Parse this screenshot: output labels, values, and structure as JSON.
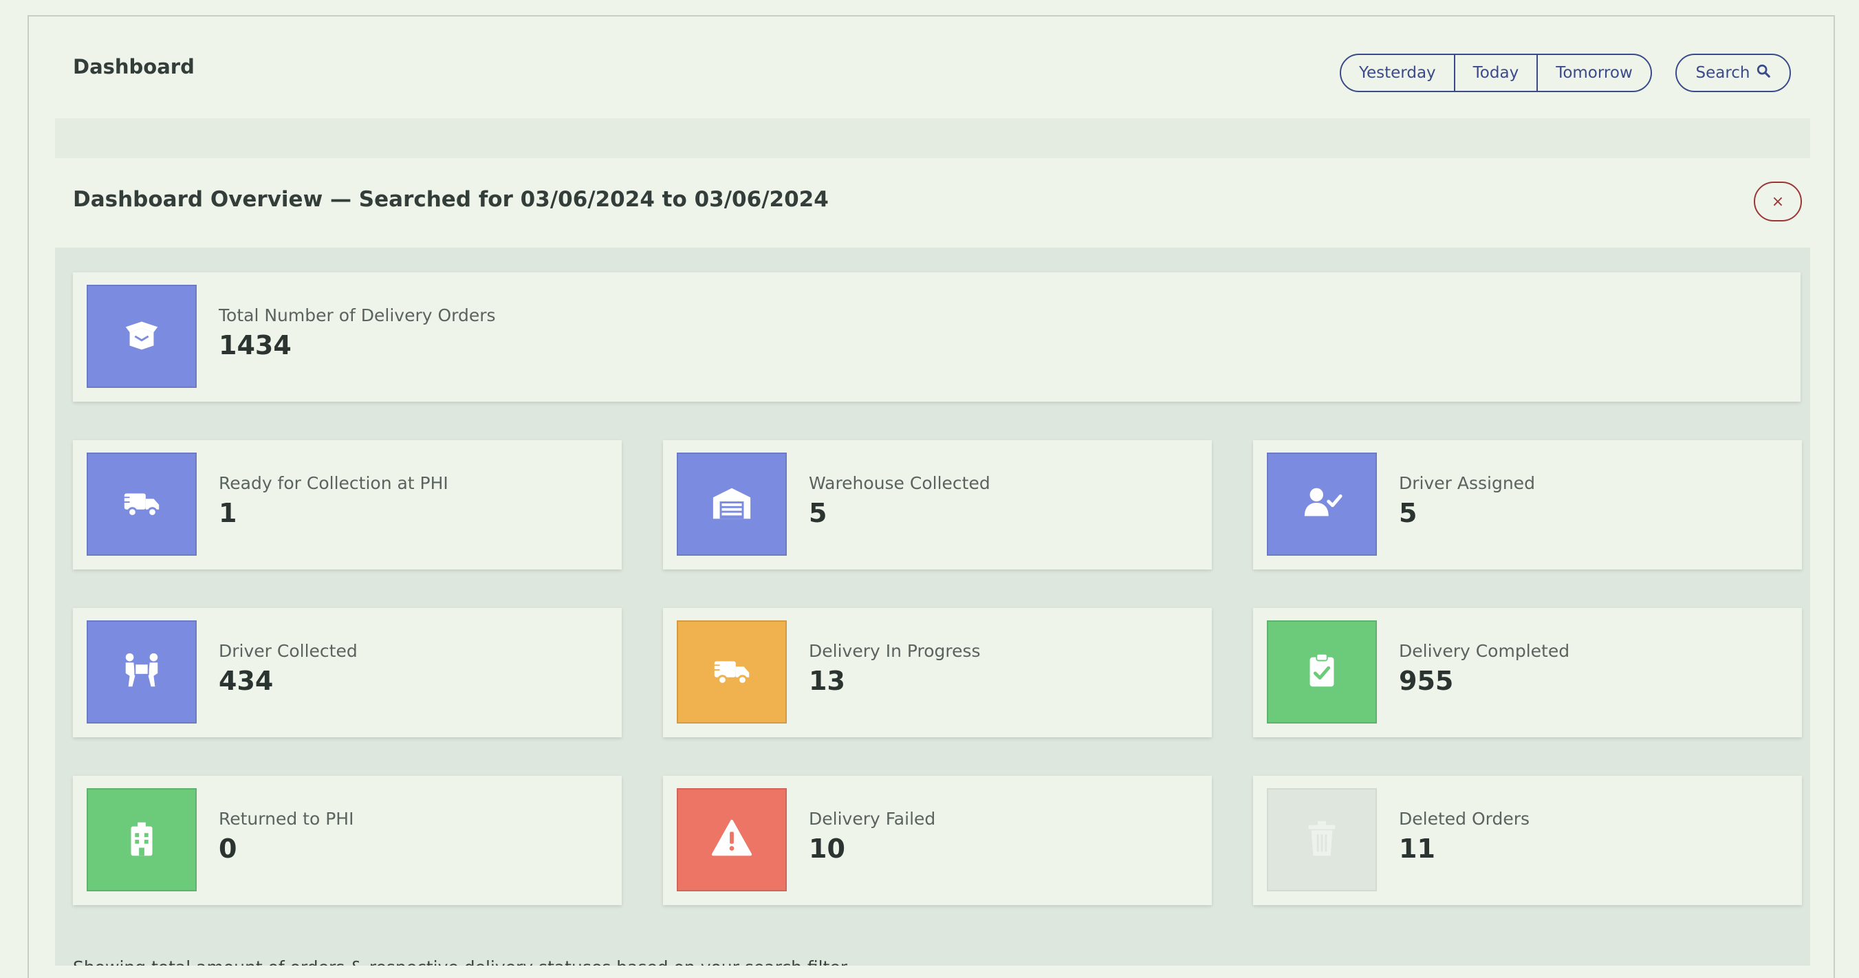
{
  "header": {
    "title": "Dashboard",
    "date_buttons": [
      "Yesterday",
      "Today",
      "Tomorrow"
    ],
    "search_label": "Search"
  },
  "overview": {
    "title": "Dashboard Overview — Searched for 03/06/2024 to 03/06/2024",
    "close_label": "×"
  },
  "colors": {
    "blue": "#7b8ce0",
    "orange": "#efb24e",
    "green": "#6ccb7a",
    "red": "#ec7566",
    "grey": "#dfe6de",
    "accent": "#3b4a8a"
  },
  "cards": {
    "total": {
      "label": "Total Number of Delivery Orders",
      "value": "1434",
      "icon": "box-open-icon"
    },
    "ready": {
      "label": "Ready for Collection at PHI",
      "value": "1",
      "icon": "shipping-truck-icon"
    },
    "warehouse": {
      "label": "Warehouse Collected",
      "value": "5",
      "icon": "warehouse-icon"
    },
    "driver_assigned": {
      "label": "Driver Assigned",
      "value": "5",
      "icon": "user-check-icon"
    },
    "driver_collected": {
      "label": "Driver Collected",
      "value": "434",
      "icon": "people-carry-icon"
    },
    "in_progress": {
      "label": "Delivery In Progress",
      "value": "13",
      "icon": "shipping-truck-icon"
    },
    "completed": {
      "label": "Delivery Completed",
      "value": "955",
      "icon": "clipboard-check-icon"
    },
    "returned": {
      "label": "Returned to PHI",
      "value": "0",
      "icon": "hospital-icon"
    },
    "failed": {
      "label": "Delivery Failed",
      "value": "10",
      "icon": "warning-icon"
    },
    "deleted": {
      "label": "Deleted Orders",
      "value": "11",
      "icon": "trash-icon"
    }
  },
  "footer_text": "Showing total amount of orders & respective delivery statuses based on your search filter"
}
